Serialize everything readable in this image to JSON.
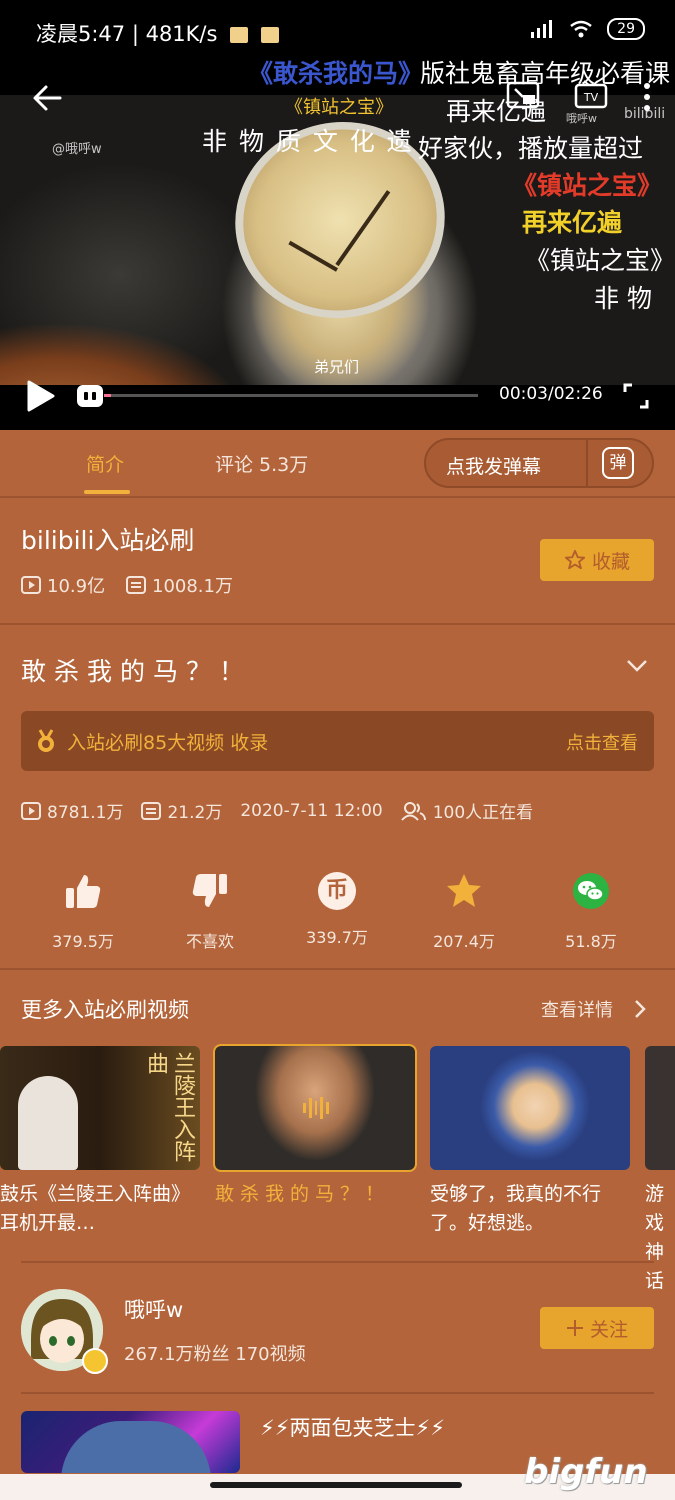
{
  "status_bar": {
    "time_speed": "凌晨5:47 | 481K/s",
    "battery": "29"
  },
  "player": {
    "danmaku": [
      {
        "text": "《敢杀我的马》",
        "color": "#3b57d0"
      },
      {
        "text": "版社鬼畜高年级必看课",
        "color": "#ffffff"
      },
      {
        "text": "《镇站之宝》",
        "color": "#f2c230"
      },
      {
        "text": "再来亿遍",
        "color": "#ffffff"
      },
      {
        "text": "非 物 质 文 化 遗",
        "color": "#ffffff"
      },
      {
        "text": "好家伙，播放量超过",
        "color": "#ffffff"
      },
      {
        "text": "《镇站之宝》",
        "color": "#e23b2a"
      },
      {
        "text": "再来亿遍",
        "color": "#f2d02a"
      },
      {
        "text": "《镇站之宝》",
        "color": "#ffffff"
      },
      {
        "text": "非 物",
        "color": "#ffffff"
      }
    ],
    "watermark_left": "@哦呼w",
    "watermark_right": "哦呼w",
    "brand_watermark": "bilibili",
    "subtitle": "弟兄们",
    "time": "00:03/02:26",
    "progress": 0.02
  },
  "tabs": {
    "intro": "简介",
    "comments": "评论 5.3万",
    "danmaku_input": "点我发弹幕",
    "danmaku_badge": "弹"
  },
  "collection": {
    "title": "bilibili入站必刷",
    "views": "10.9亿",
    "danmaku": "1008.1万",
    "fav_button": "收藏"
  },
  "video": {
    "title": "敢杀我的马？！",
    "rank_text": "入站必刷85大视频 收录",
    "rank_link": "点击查看",
    "views": "8781.1万",
    "danmaku": "21.2万",
    "date": "2020-7-11 12:00",
    "watching": "100人正在看"
  },
  "actions": [
    {
      "name": "like",
      "label": "379.5万"
    },
    {
      "name": "dislike",
      "label": "不喜欢"
    },
    {
      "name": "coin",
      "label": "339.7万",
      "glyph": "币"
    },
    {
      "name": "favorite",
      "label": "207.4万"
    },
    {
      "name": "share",
      "label": "51.8万"
    }
  ],
  "more": {
    "title": "更多入站必刷视频",
    "link": "查看详情",
    "cards": [
      {
        "title": "鼓乐《兰陵王入阵曲》耳机开最…",
        "thumb_text": "兰陵王入阵曲"
      },
      {
        "title": "敢杀我的马？！"
      },
      {
        "title": "受够了，我真的不行了。好想逃。"
      },
      {
        "title": "游戏神话"
      }
    ]
  },
  "uploader": {
    "name": "哦呼w",
    "stats": "267.1万粉丝   170视频",
    "follow": "关注"
  },
  "related": {
    "title": "⚡⚡两面包夹芝士⚡⚡"
  },
  "brand": "bigfun",
  "colors": {
    "background": "#b3643a",
    "accent": "#f1b13a",
    "button": "#e7a52d",
    "divider": "#9c5330"
  }
}
